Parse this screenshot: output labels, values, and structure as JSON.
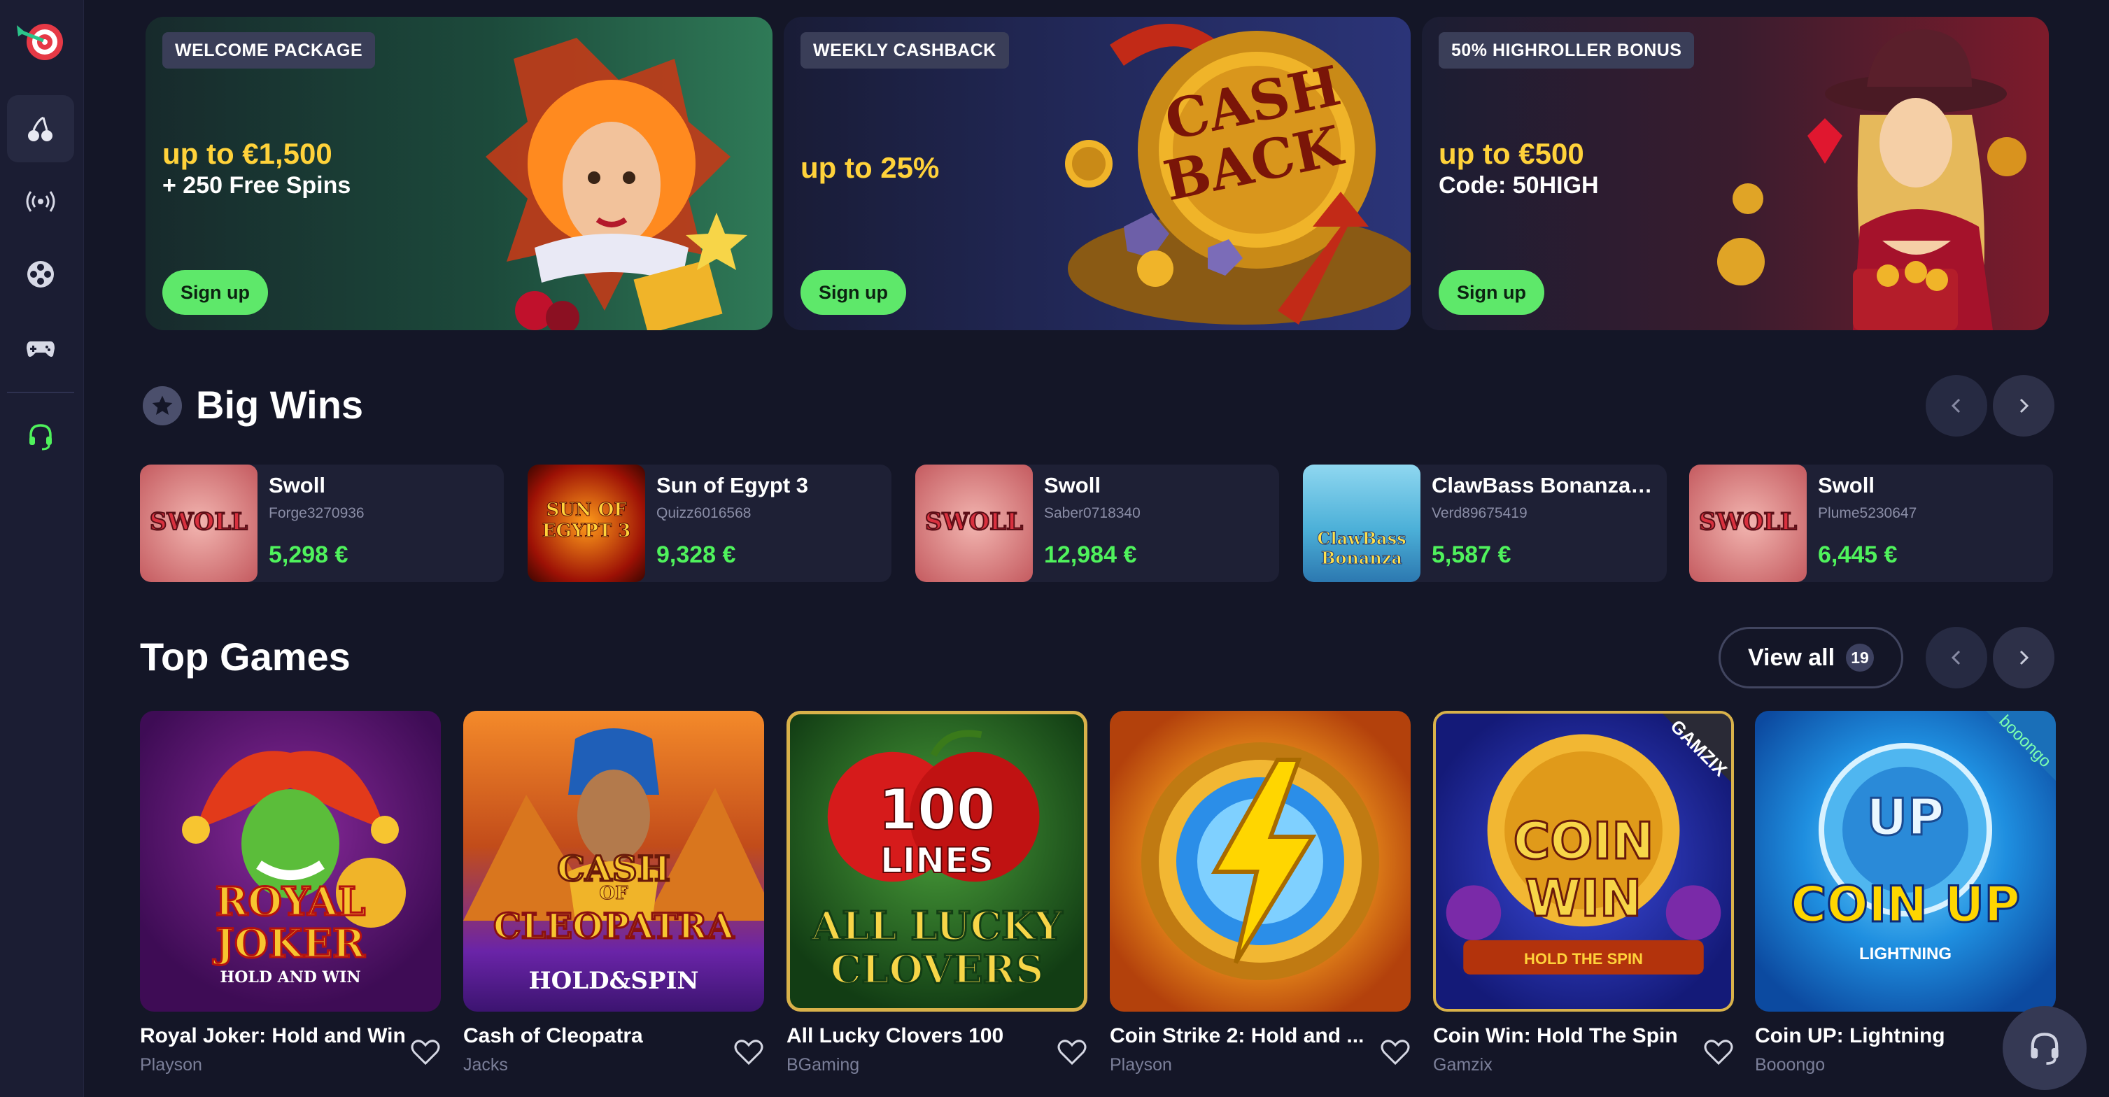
{
  "sidebar": {
    "items": [
      {
        "icon": "cherries-icon"
      },
      {
        "icon": "live-broadcast-icon"
      },
      {
        "icon": "film-reel-icon"
      },
      {
        "icon": "gamepad-icon"
      },
      {
        "icon": "headset-icon"
      }
    ]
  },
  "banners": [
    {
      "tag": "WELCOME PACKAGE",
      "title": "up to €1,500",
      "subtitle": "+ 250 Free Spins",
      "button": "Sign up"
    },
    {
      "tag": "WEEKLY CASHBACK",
      "title": "up to 25%",
      "subtitle": "",
      "button": "Sign up",
      "art_text": [
        "CASH",
        "BACK"
      ]
    },
    {
      "tag": "50% HIGHROLLER BONUS",
      "title": "up to €500",
      "subtitle": "Code: 50HIGH",
      "button": "Sign up"
    }
  ],
  "big_wins": {
    "title": "Big Wins",
    "items": [
      {
        "game": "Swoll",
        "user": "Forge3270936",
        "amount": "5,298 €",
        "thumb_text": "SWOLL"
      },
      {
        "game": "Sun of Egypt 3",
        "user": "Quizz6016568",
        "amount": "9,328 €",
        "thumb_text": "SUN OF EGYPT 3"
      },
      {
        "game": "Swoll",
        "user": "Saber0718340",
        "amount": "12,984 €",
        "thumb_text": "SWOLL"
      },
      {
        "game": "ClawBass Bonanza: ...",
        "user": "Verd89675419",
        "amount": "5,587 €",
        "thumb_text": "ClawBass Bonanza"
      },
      {
        "game": "Swoll",
        "user": "Plume5230647",
        "amount": "6,445 €",
        "thumb_text": "SWOLL"
      }
    ]
  },
  "top_games": {
    "title": "Top Games",
    "view_all": "View all",
    "count": "19",
    "items": [
      {
        "name": "Royal Joker: Hold and Win",
        "provider": "Playson",
        "art": [
          "ROYAL",
          "JOKER",
          "HOLD AND WIN"
        ]
      },
      {
        "name": "Cash of Cleopatra",
        "provider": "Jacks",
        "art": [
          "CASH",
          "OF",
          "CLEOPATRA",
          "HOLD&SPIN"
        ]
      },
      {
        "name": "All Lucky Clovers 100",
        "provider": "BGaming",
        "art": [
          "100",
          "LINES",
          "ALL LUCKY",
          "CLOVERS"
        ]
      },
      {
        "name": "Coin Strike 2: Hold and ...",
        "provider": "Playson",
        "art": []
      },
      {
        "name": "Coin Win: Hold The Spin",
        "provider": "Gamzix",
        "art": [
          "COIN",
          "WIN",
          "HOLD THE SPIN",
          "GAMZIX"
        ]
      },
      {
        "name": "Coin UP: Lightning",
        "provider": "Booongo",
        "art": [
          "UP",
          "COIN UP",
          "LIGHTNING",
          "booongo"
        ]
      }
    ]
  },
  "colors": {
    "background": "#141627",
    "accent_green": "#5ee86a",
    "win_green": "#4ff25c",
    "banner_title_yellow": "#ffd23a"
  }
}
